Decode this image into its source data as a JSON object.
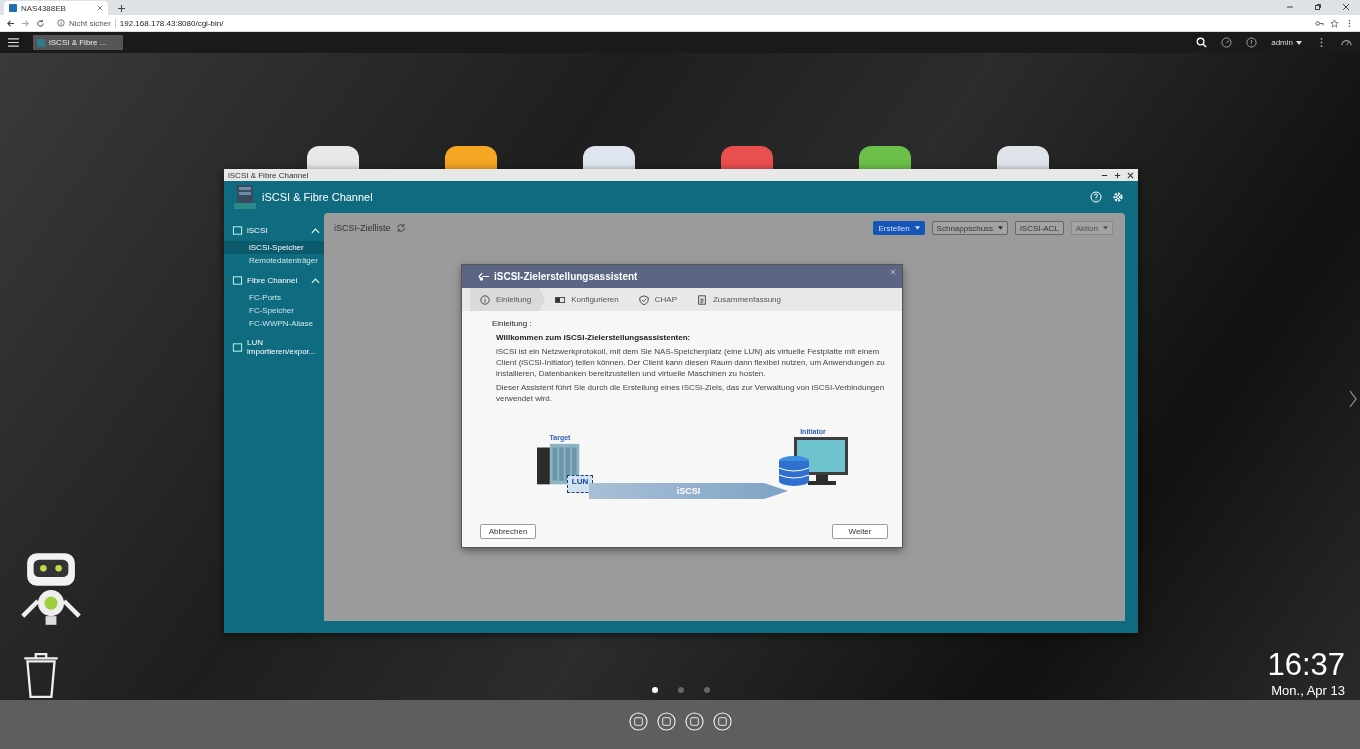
{
  "browser": {
    "tab_title": "NAS4388EB",
    "security": "Nicht sicher",
    "address": "192.168.178.43:8080/cgi-bin/"
  },
  "nas_bar": {
    "task_tab": "iSCSI & Fibre ...",
    "user": "admin"
  },
  "desktop_icons": [
    {
      "color": "#e8e8e8"
    },
    {
      "color": "#f5a623"
    },
    {
      "color": "#dfe6ef"
    },
    {
      "color": "#e94f4f"
    },
    {
      "color": "#6cc04a"
    },
    {
      "color": "#dfe4ea"
    }
  ],
  "window": {
    "title": "iSCSI & Fibre Channel",
    "header": "iSCSI & Fibre Channel",
    "sidebar": [
      {
        "label": "iSCSI",
        "expanded": true,
        "children": [
          {
            "label": "iSCSI-Speicher",
            "selected": true
          },
          {
            "label": "Remotedatenträger",
            "selected": false
          }
        ]
      },
      {
        "label": "Fibre Channel",
        "expanded": true,
        "children": [
          {
            "label": "FC-Ports",
            "selected": false
          },
          {
            "label": "FC-Speicher",
            "selected": false
          },
          {
            "label": "FC-WWPN-Aliase",
            "selected": false
          }
        ]
      },
      {
        "label": "LUN importieren/expor..."
      }
    ],
    "content_title": "iSCSI-Zielliste",
    "buttons": [
      {
        "label": "Erstellen",
        "primary": true,
        "dropdown": true,
        "disabled": false
      },
      {
        "label": "Schnappschuss",
        "primary": false,
        "dropdown": true,
        "disabled": false
      },
      {
        "label": "iSCSI-ACL",
        "primary": false,
        "dropdown": false,
        "disabled": false
      },
      {
        "label": "Aktion",
        "primary": false,
        "dropdown": true,
        "disabled": true
      }
    ]
  },
  "dialog": {
    "title": "iSCSI-Zielerstellungsassistent",
    "steps": [
      {
        "label": "Einleitung",
        "kind": "info",
        "selected": true
      },
      {
        "label": "Konfigurieren",
        "kind": "config",
        "selected": false
      },
      {
        "label": "CHAP",
        "kind": "shield",
        "selected": false
      },
      {
        "label": "Zusammenfassung",
        "kind": "summary",
        "selected": false
      }
    ],
    "heading": "Einleitung :",
    "welcome": "Willkommen zum iSCSI-Zielerstellungsassistenten:",
    "paragraphs": [
      "iSCSI ist ein Netzwerkprotokoll, mit dem Sie NAS-Speicherplatz (eine LUN) als virtuelle Festplatte mit einem Client (iSCSI-Initiator) teilen können. Der Client kann diesen Raum dann flexibel nutzen, um Anwendungen zu installieren, Datenbanken bereitzustellen und virtuelle Maschinen zu hosten.",
      "Dieser Assistent führt Sie durch die Erstellung eines iSCSI-Ziels, das zur Verwaltung von iSCSI-Verbindungen verwendet wird."
    ],
    "diagram": {
      "target": "Target",
      "initiator": "Initiator",
      "lun": "LUN",
      "protocol": "iSCSI"
    },
    "cancel": "Abbrechen",
    "next": "Weiter"
  },
  "page_dots": [
    {
      "selected": true
    },
    {
      "selected": false
    },
    {
      "selected": false
    }
  ],
  "clock": {
    "time": "16:37",
    "date": "Mon., Apr 13"
  }
}
